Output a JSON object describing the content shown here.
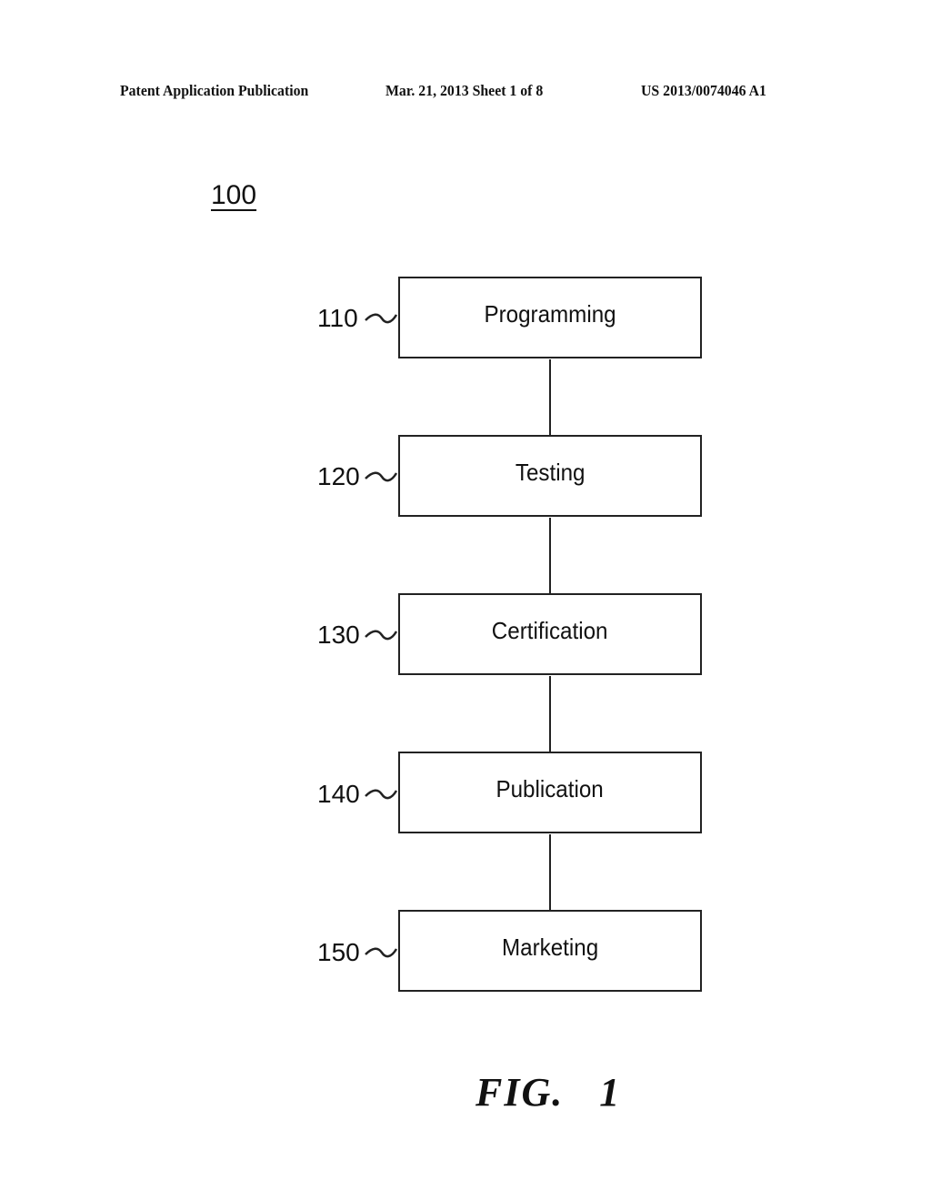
{
  "header": {
    "publication_type": "Patent Application Publication",
    "date_sheet": "Mar. 21, 2013  Sheet 1 of 8",
    "publication_number": "US 2013/0074046 A1"
  },
  "diagram": {
    "reference": "100",
    "steps": [
      {
        "ref": "110",
        "label": "Programming"
      },
      {
        "ref": "120",
        "label": "Testing"
      },
      {
        "ref": "130",
        "label": "Certification"
      },
      {
        "ref": "140",
        "label": "Publication"
      },
      {
        "ref": "150",
        "label": "Marketing"
      }
    ],
    "figure_label": "FIG.   1"
  }
}
